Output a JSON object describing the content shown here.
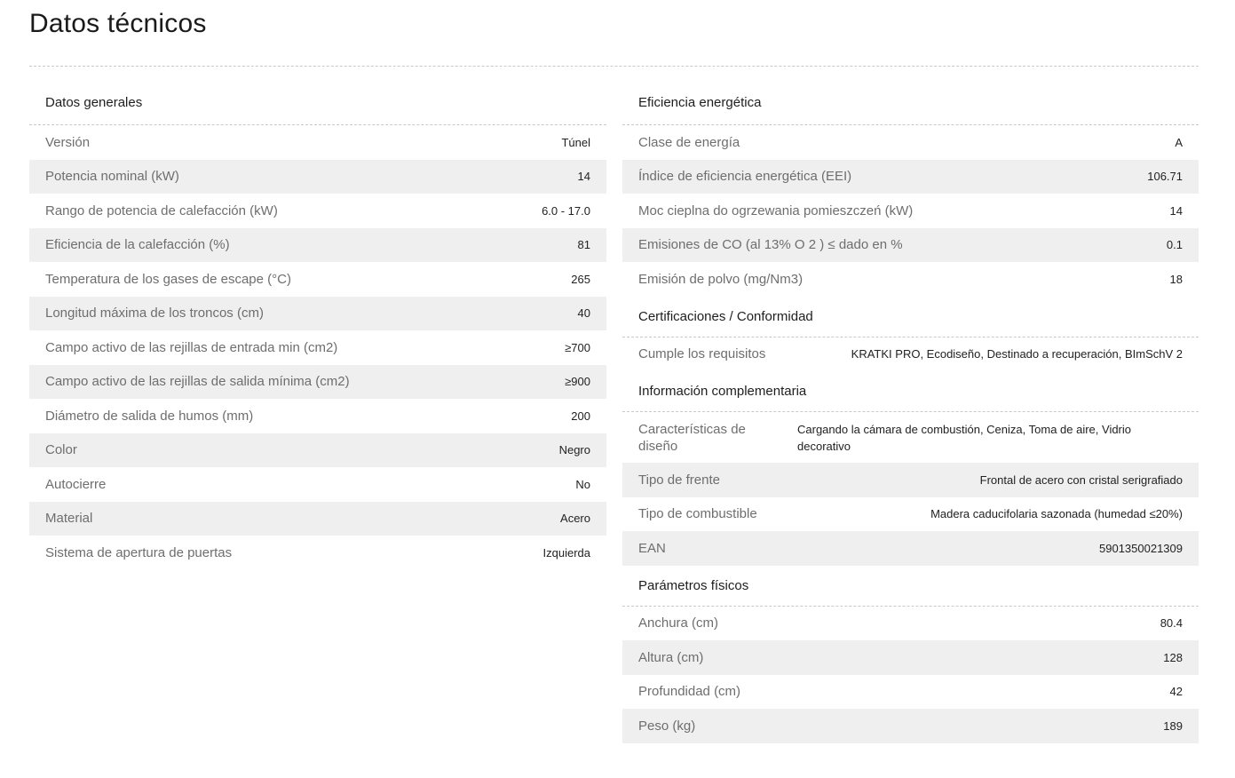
{
  "page": {
    "title": "Datos técnicos"
  },
  "left": {
    "sections": [
      {
        "title": "Datos generales",
        "rows": [
          {
            "label": "Versión",
            "value": "Túnel"
          },
          {
            "label": "Potencia nominal (kW)",
            "value": "14"
          },
          {
            "label": "Rango de potencia de calefacción (kW)",
            "value": "6.0 - 17.0"
          },
          {
            "label": "Eficiencia de la calefacción (%)",
            "value": "81"
          },
          {
            "label": "Temperatura de los gases de escape (°C)",
            "value": "265"
          },
          {
            "label": "Longitud máxima de los troncos (cm)",
            "value": "40"
          },
          {
            "label": "Campo activo de las rejillas de entrada min (cm2)",
            "value": "≥700"
          },
          {
            "label": "Campo activo de las rejillas de salida mínima (cm2)",
            "value": "≥900"
          },
          {
            "label": "Diámetro de salida de humos (mm)",
            "value": "200"
          },
          {
            "label": "Color",
            "value": "Negro"
          },
          {
            "label": "Autocierre",
            "value": "No"
          },
          {
            "label": "Material",
            "value": "Acero"
          },
          {
            "label": "Sistema de apertura de puertas",
            "value": "Izquierda"
          }
        ]
      }
    ]
  },
  "right": {
    "sections": [
      {
        "title": "Eficiencia energética",
        "rows": [
          {
            "label": "Clase de energía",
            "value": "A"
          },
          {
            "label": "Índice de eficiencia energética (EEI)",
            "value": "106.71"
          },
          {
            "label": "Moc cieplna do ogrzewania pomieszczeń (kW)",
            "value": "14"
          },
          {
            "label": "Emisiones de CO (al 13% O 2 ) ≤ dado en %",
            "value": "0.1"
          },
          {
            "label": "Emisión de polvo (mg/Nm3)",
            "value": "18"
          }
        ]
      },
      {
        "title": "Certificaciones / Conformidad",
        "rows": [
          {
            "label": "Cumple los requisitos",
            "value": "KRATKI PRO, Ecodiseño, Destinado a recuperación, BImSchV 2"
          }
        ]
      },
      {
        "title": "Información complementaria",
        "rows": [
          {
            "label": "Características de diseño",
            "value": "Cargando la cámara de combustión, Ceniza, Toma de aire, Vidrio decorativo"
          },
          {
            "label": "Tipo de frente",
            "value": "Frontal de acero con cristal serigrafiado"
          },
          {
            "label": "Tipo de combustible",
            "value": "Madera caducifolaria sazonada (humedad ≤20%)"
          },
          {
            "label": "EAN",
            "value": "5901350021309"
          }
        ]
      },
      {
        "title": "Parámetros físicos",
        "rows": [
          {
            "label": "Anchura (cm)",
            "value": "80.4"
          },
          {
            "label": "Altura (cm)",
            "value": "128"
          },
          {
            "label": "Profundidad (cm)",
            "value": "42"
          },
          {
            "label": "Peso (kg)",
            "value": "189"
          }
        ]
      }
    ]
  }
}
